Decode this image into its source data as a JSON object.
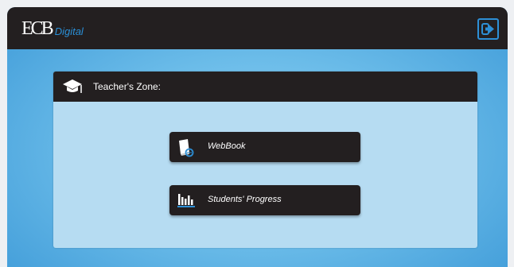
{
  "header": {
    "logo_mark": "ECB",
    "logo_sub": "Digital",
    "exit_icon": "sign-out-icon"
  },
  "zone": {
    "icon": "graduation-cap-icon",
    "title": "Teacher's Zone:"
  },
  "buttons": {
    "webbook": {
      "label": "WebBook",
      "icon": "book-icon"
    },
    "progress": {
      "label": "Students' Progress",
      "icon": "bar-chart-icon"
    }
  },
  "colors": {
    "dark": "#231f20",
    "accent": "#2d8fd6",
    "panel": "#b6dcf2",
    "background": "#6bbce9"
  }
}
